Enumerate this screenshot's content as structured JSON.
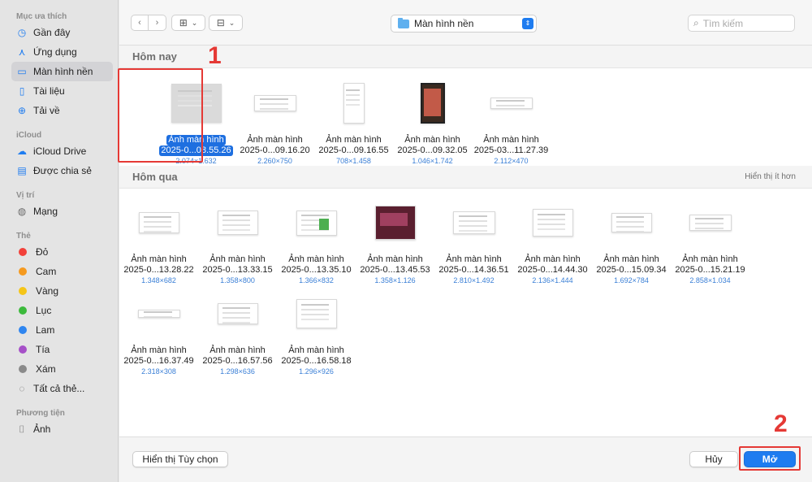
{
  "sidebar": {
    "favorites_header": "Mục ưa thích",
    "favorites": [
      {
        "label": "Gần đây",
        "icon": "clock-icon"
      },
      {
        "label": "Ứng dụng",
        "icon": "apps-icon"
      },
      {
        "label": "Màn hình nền",
        "icon": "desktop-icon"
      },
      {
        "label": "Tài liệu",
        "icon": "document-icon"
      },
      {
        "label": "Tải về",
        "icon": "download-icon"
      }
    ],
    "icloud_header": "iCloud",
    "icloud": [
      {
        "label": "iCloud Drive",
        "icon": "cloud-icon"
      },
      {
        "label": "Được chia sẻ",
        "icon": "shared-folder-icon"
      }
    ],
    "location_header": "Vị trí",
    "locations": [
      {
        "label": "Mạng",
        "icon": "network-icon"
      }
    ],
    "tags_header": "Thẻ",
    "tags": [
      {
        "label": "Đỏ",
        "color": "#f2413a"
      },
      {
        "label": "Cam",
        "color": "#f59a1f"
      },
      {
        "label": "Vàng",
        "color": "#f5c518"
      },
      {
        "label": "Lục",
        "color": "#3cba3c"
      },
      {
        "label": "Lam",
        "color": "#2f86f0"
      },
      {
        "label": "Tía",
        "color": "#a650c8"
      },
      {
        "label": "Xám",
        "color": "#8a8a8a"
      },
      {
        "label": "Tất cả thẻ...",
        "color": ""
      }
    ],
    "media_header": "Phương tiện",
    "media": [
      {
        "label": "Ảnh",
        "icon": "camera-icon"
      }
    ]
  },
  "toolbar": {
    "location": "Màn hình nền",
    "search_placeholder": "Tìm kiếm"
  },
  "sections": {
    "today": "Hôm nay",
    "yesterday": "Hôm qua",
    "show_less": "Hiển thị ít hơn"
  },
  "files_today": [
    {
      "name1": "Ảnh màn hình",
      "name2": "2025-0...08.55.26",
      "dims": "2.074×1.632"
    },
    {
      "name1": "Ảnh màn hình",
      "name2": "2025-0...09.16.20",
      "dims": "2.260×750"
    },
    {
      "name1": "Ảnh màn hình",
      "name2": "2025-0...09.16.55",
      "dims": "708×1.458"
    },
    {
      "name1": "Ảnh màn hình",
      "name2": "2025-0...09.32.05",
      "dims": "1.046×1.742"
    },
    {
      "name1": "Ảnh màn hình",
      "name2": "2025-03...11.27.39",
      "dims": "2.112×470"
    }
  ],
  "files_yesterday": [
    {
      "name1": "Ảnh màn hình",
      "name2": "2025-0...13.28.22",
      "dims": "1.348×682"
    },
    {
      "name1": "Ảnh màn hình",
      "name2": "2025-0...13.33.15",
      "dims": "1.358×800"
    },
    {
      "name1": "Ảnh màn hình",
      "name2": "2025-0...13.35.10",
      "dims": "1.366×832"
    },
    {
      "name1": "Ảnh màn hình",
      "name2": "2025-0...13.45.53",
      "dims": "1.358×1.126"
    },
    {
      "name1": "Ảnh màn hình",
      "name2": "2025-0...14.36.51",
      "dims": "2.810×1.492"
    },
    {
      "name1": "Ảnh màn hình",
      "name2": "2025-0...14.44.30",
      "dims": "2.136×1.444"
    },
    {
      "name1": "Ảnh màn hình",
      "name2": "2025-0...15.09.34",
      "dims": "1.692×784"
    },
    {
      "name1": "Ảnh màn hình",
      "name2": "2025-0...15.21.19",
      "dims": "2.858×1.034"
    },
    {
      "name1": "Ảnh màn hình",
      "name2": "2025-0...16.37.49",
      "dims": "2.318×308"
    },
    {
      "name1": "Ảnh màn hình",
      "name2": "2025-0...16.57.56",
      "dims": "1.298×636"
    },
    {
      "name1": "Ảnh màn hình",
      "name2": "2025-0...16.58.18",
      "dims": "1.296×926"
    }
  ],
  "footer": {
    "options_label": "Hiển thị Tùy chọn",
    "cancel_label": "Hủy",
    "open_label": "Mở"
  },
  "annotations": {
    "step1": "1",
    "step2": "2"
  },
  "colors": {
    "accent": "#1e7cf0",
    "annotation_red": "#e53935"
  }
}
